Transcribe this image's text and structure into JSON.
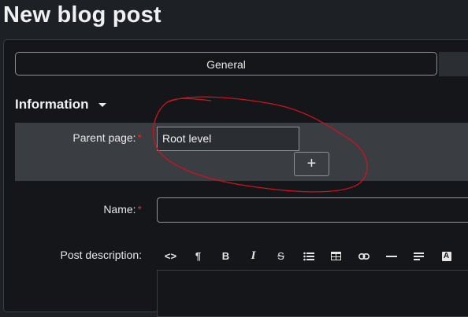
{
  "page": {
    "title": "New blog post"
  },
  "tabs": [
    {
      "label": "General"
    }
  ],
  "section": {
    "title": "Information"
  },
  "fields": {
    "parent_page": {
      "label": "Parent page:",
      "value": "Root level",
      "required_mark": "*",
      "add_label": "+"
    },
    "name": {
      "label": "Name:",
      "required_mark": "*",
      "value": ""
    },
    "post_description": {
      "label": "Post description:"
    }
  },
  "toolbar": {
    "buttons": [
      {
        "icon": "code-icon",
        "glyph": "<>"
      },
      {
        "icon": "paragraph-icon",
        "glyph": "¶"
      },
      {
        "icon": "bold-icon",
        "glyph": "B"
      },
      {
        "icon": "italic-icon",
        "glyph": "I"
      },
      {
        "icon": "strikethrough-icon",
        "glyph": "S"
      },
      {
        "icon": "bullet-list-icon",
        "glyph": ""
      },
      {
        "icon": "table-icon",
        "glyph": ""
      },
      {
        "icon": "link-icon",
        "glyph": ""
      },
      {
        "icon": "horizontal-rule-icon",
        "glyph": ""
      },
      {
        "icon": "align-icon",
        "glyph": ""
      },
      {
        "icon": "text-color-icon",
        "glyph": "A"
      }
    ]
  },
  "annotation": {
    "color": "#d0121e"
  }
}
